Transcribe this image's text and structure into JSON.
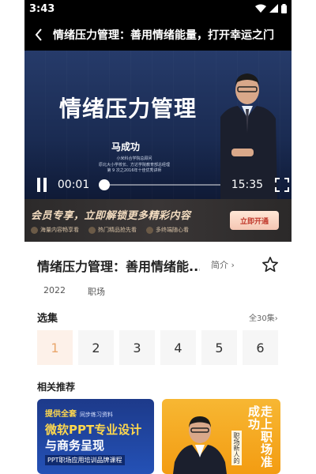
{
  "status_bar": {
    "time": "3:43"
  },
  "header": {
    "title": "情绪压力管理：善用情绪能量，打开幸运之门"
  },
  "video": {
    "course_title": "情绪压力管理",
    "teacher_name": "马成功",
    "teacher_lines": [
      "小米科合学院总顾问",
      "原北大小学校长、方达学院教育部总经理",
      "第 9 次之2016年十佳优秀讲师"
    ],
    "current_time": "00:01",
    "duration": "15:35",
    "progress": 0.0
  },
  "vip_banner": {
    "headline": "会员专享，立即解锁更多精彩内容",
    "features": [
      "海量内容畅享看",
      "热门精品抢先看",
      "多终端随心看"
    ],
    "button": "立即开通",
    "colors": {
      "accent": "#f3dcc0",
      "button_text": "#c0392b"
    }
  },
  "info": {
    "title": "情绪压力管理：善用情绪能...",
    "intro": "简介",
    "tags": [
      "2022",
      "职场"
    ]
  },
  "episodes": {
    "label": "选集",
    "all": "全30集",
    "items": [
      "1",
      "2",
      "3",
      "4",
      "5",
      "6"
    ],
    "active_index": 0,
    "active_color": "#e9a66b"
  },
  "related": {
    "label": "相关推荐",
    "cards": [
      {
        "badge": "提供全套",
        "small": "同步练习资料",
        "line1": "微软PPT专业设计",
        "line2": "与商务呈现",
        "line3": "PPT职场应用培训品牌课程"
      },
      {
        "vertical": "走上职场准成功",
        "small": "职场新人的"
      }
    ]
  }
}
